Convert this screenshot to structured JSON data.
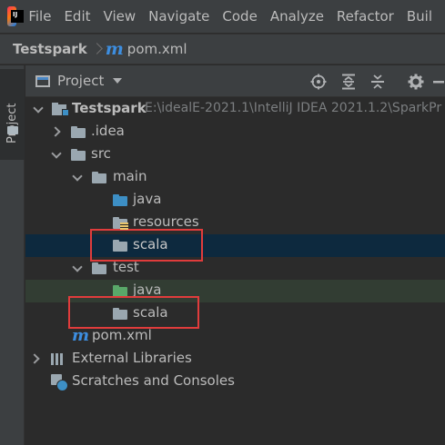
{
  "menu": {
    "logo_text": "IJ",
    "items": [
      "File",
      "Edit",
      "View",
      "Navigate",
      "Code",
      "Analyze",
      "Refactor",
      "Buil"
    ]
  },
  "breadcrumb": {
    "project": "Testspark",
    "file_icon": "m",
    "file": "pom.xml"
  },
  "stripe": {
    "tab_label": "Project"
  },
  "panel": {
    "title": "Project",
    "toolbar_icons": [
      "locate-icon",
      "expand-all-icon",
      "collapse-all-icon",
      "gear-icon",
      "minimize-icon"
    ]
  },
  "tree": {
    "root": {
      "label": "Testspark",
      "path": "E:\\idealE-2021.1\\IntelliJ IDEA 2021.1.2\\SparkPr"
    },
    "idea": ".idea",
    "src": "src",
    "main": "main",
    "main_java": "java",
    "main_resources": "resources",
    "main_scala": "scala",
    "test": "test",
    "test_java": "java",
    "test_scala": "scala",
    "pom_icon": "m",
    "pom": "pom.xml",
    "ext_libs": "External Libraries",
    "scratches": "Scratches and Consoles"
  },
  "colors": {
    "highlight_box": "#e03c3c",
    "selection": "#0d293e",
    "source_folder": "#3d8fc5",
    "test_folder": "#59a869"
  }
}
